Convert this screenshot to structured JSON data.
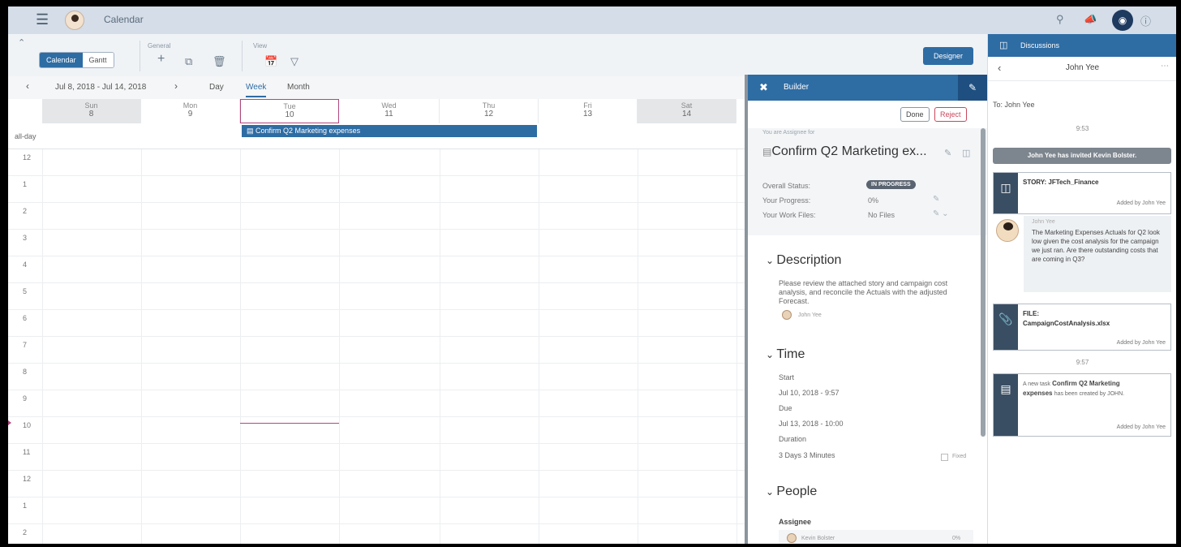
{
  "shell": {
    "title": "Calendar",
    "icons": [
      "menu-icon",
      "search-icon",
      "megaphone-icon",
      "notifications-icon",
      "help-icon"
    ]
  },
  "toolbar": {
    "view_tabs": [
      "Calendar",
      "Gantt"
    ],
    "general_label": "General",
    "view_label": "View",
    "designer_label": "Designer"
  },
  "datenav": {
    "range": "Jul 8, 2018 - Jul 14, 2018",
    "modes": [
      "Day",
      "Week",
      "Month"
    ],
    "active_mode": "Week"
  },
  "calendar": {
    "days": [
      {
        "name": "Sun",
        "num": "8"
      },
      {
        "name": "Mon",
        "num": "9"
      },
      {
        "name": "Tue",
        "num": "10"
      },
      {
        "name": "Wed",
        "num": "11"
      },
      {
        "name": "Thu",
        "num": "12"
      },
      {
        "name": "Fri",
        "num": "13"
      },
      {
        "name": "Sat",
        "num": "14"
      }
    ],
    "today_index": 2,
    "allday_label": "all-day",
    "event_title": "Confirm Q2 Marketing expenses",
    "hours": [
      "12",
      "1",
      "2",
      "3",
      "4",
      "5",
      "6",
      "7",
      "8",
      "9",
      "10",
      "11",
      "12",
      "1",
      "2"
    ]
  },
  "builder": {
    "title": "Builder",
    "done": "Done",
    "reject": "Reject",
    "assignee_note": "You are Assignee for",
    "task_title": "Confirm Q2 Marketing ex...",
    "overall_status_label": "Overall Status:",
    "overall_status_value": "IN PROGRESS",
    "progress_label": "Your Progress:",
    "progress_value": "0%",
    "work_files_label": "Your Work Files:",
    "work_files_value": "No Files",
    "description_header": "Description",
    "description_text": "Please review the attached story and campaign cost analysis, and reconcile the Actuals with the adjusted Forecast.",
    "description_author": "John Yee",
    "time_header": "Time",
    "start_label": "Start",
    "start_value": "Jul 10, 2018 - 9:57",
    "due_label": "Due",
    "due_value": "Jul 13, 2018 - 10:00",
    "duration_label": "Duration",
    "duration_value": "3 Days 3 Minutes",
    "fixed_label": "Fixed",
    "people_header": "People",
    "assignee_label": "Assignee",
    "assignee_name": "Kevin Bolster",
    "assignee_progress": "0%"
  },
  "discussions": {
    "title": "Discussions",
    "contact": "John Yee",
    "to": "To: John Yee",
    "time1": "9:53",
    "system_message": "John Yee has invited Kevin Bolster.",
    "story_title": "STORY: JFTech_Finance",
    "added_by": "Added by John Yee",
    "msg_author": "John Yee",
    "msg_text": "The Marketing Expenses Actuals for Q2 look low given the cost analysis for the campaign we just ran. Are there outstanding costs that are coming in Q3?",
    "file_label": "FILE:",
    "file_name": "CampaignCostAnalysis.xlsx",
    "time2": "9:57",
    "task_pre": "A new task",
    "task_name": "Confirm Q2 Marketing expenses",
    "task_post": "has been created by JOHN."
  },
  "colors": {
    "accent": "#2e6ca4",
    "today_border": "#b0477b",
    "reject": "#c9475c",
    "shell": "#d4dde8"
  }
}
